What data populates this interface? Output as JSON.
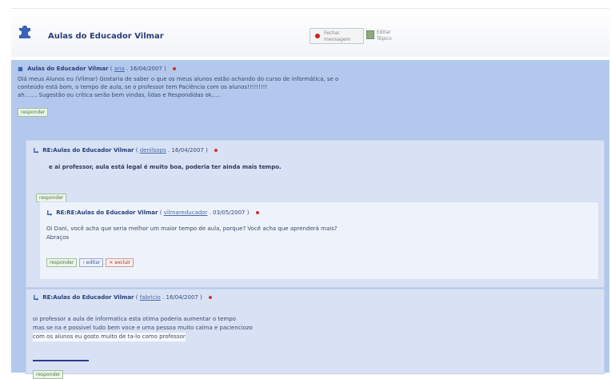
{
  "header": {
    "title": "Aulas do Educador Vilmar",
    "close_button": "Fechar mensagem",
    "edit_button": "Editar Tópico"
  },
  "main_post": {
    "title": "Aulas do Educador Vilmar",
    "author": "ana",
    "date": "16/04/2007",
    "lines": [
      "Olá meus Alunos eu (Vilmar) Gostaria de saber o que os meus alunos estão achando do curso de informática, se o",
      "conteúdo está bom, o tempo de aula, se o professor tem Paciência com os alunos!!!!!!!!!",
      "ah....... Sugestão ou crítica serão bem vindas, lidas e Respondidas ok....."
    ],
    "reply_label": "responder"
  },
  "reply1": {
    "title": "RE:Aulas do Educador Vilmar",
    "author": "denilsops",
    "date": "16/04/2007",
    "text": "e ai professor, aula está legal é muito boa, poderia ter ainda mais tempo.",
    "reply_label": "responder"
  },
  "nested_reply": {
    "title": "RE:RE:Aulas do Educador Vilmar",
    "author": "vilmareducador",
    "date": "03/05/2007",
    "lines": [
      "Oi Dani, você acha que seria melhor um maior tempo de aula, porque? Você acha que aprenderá mais?",
      "Abraços"
    ],
    "reply_label": "responder",
    "edit_label": "editar",
    "delete_label": "excluir"
  },
  "reply2": {
    "title": "RE:Aulas do Educador Vilmar",
    "author": "fabricio",
    "date": "16/04/2007",
    "lines": [
      "oi professor a aula de informatica esta otima poderia aumentar o tempo",
      "mas se na e possivel tudo bem voce e uma pessoa muito calma e pacienciozo",
      "com os alunos eu gosto muito de ta-lo como professor"
    ],
    "reply_label": "responder"
  },
  "colors": {
    "thread_bg": "#b3c8ec",
    "reply_bg": "#d8e2f4",
    "nested_bg": "#eef2fa",
    "accent": "#27407c"
  }
}
